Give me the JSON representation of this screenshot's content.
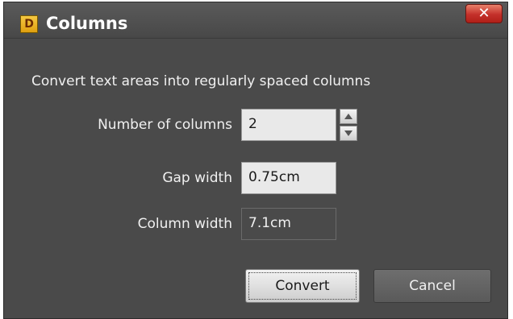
{
  "dialog": {
    "title": "Columns",
    "app_icon_letter": "D",
    "close_symbol": "✕",
    "description": "Convert text areas into regularly spaced columns"
  },
  "fields": {
    "number_of_columns": {
      "label": "Number of columns",
      "value": "2"
    },
    "gap_width": {
      "label": "Gap width",
      "value": "0.75cm"
    },
    "column_width": {
      "label": "Column width",
      "value": "7.1cm"
    }
  },
  "buttons": {
    "convert": "Convert",
    "cancel": "Cancel"
  },
  "colors": {
    "window_bg": "#4a4a4a",
    "close_button": "#c4302a",
    "app_icon": "#f0b429"
  }
}
